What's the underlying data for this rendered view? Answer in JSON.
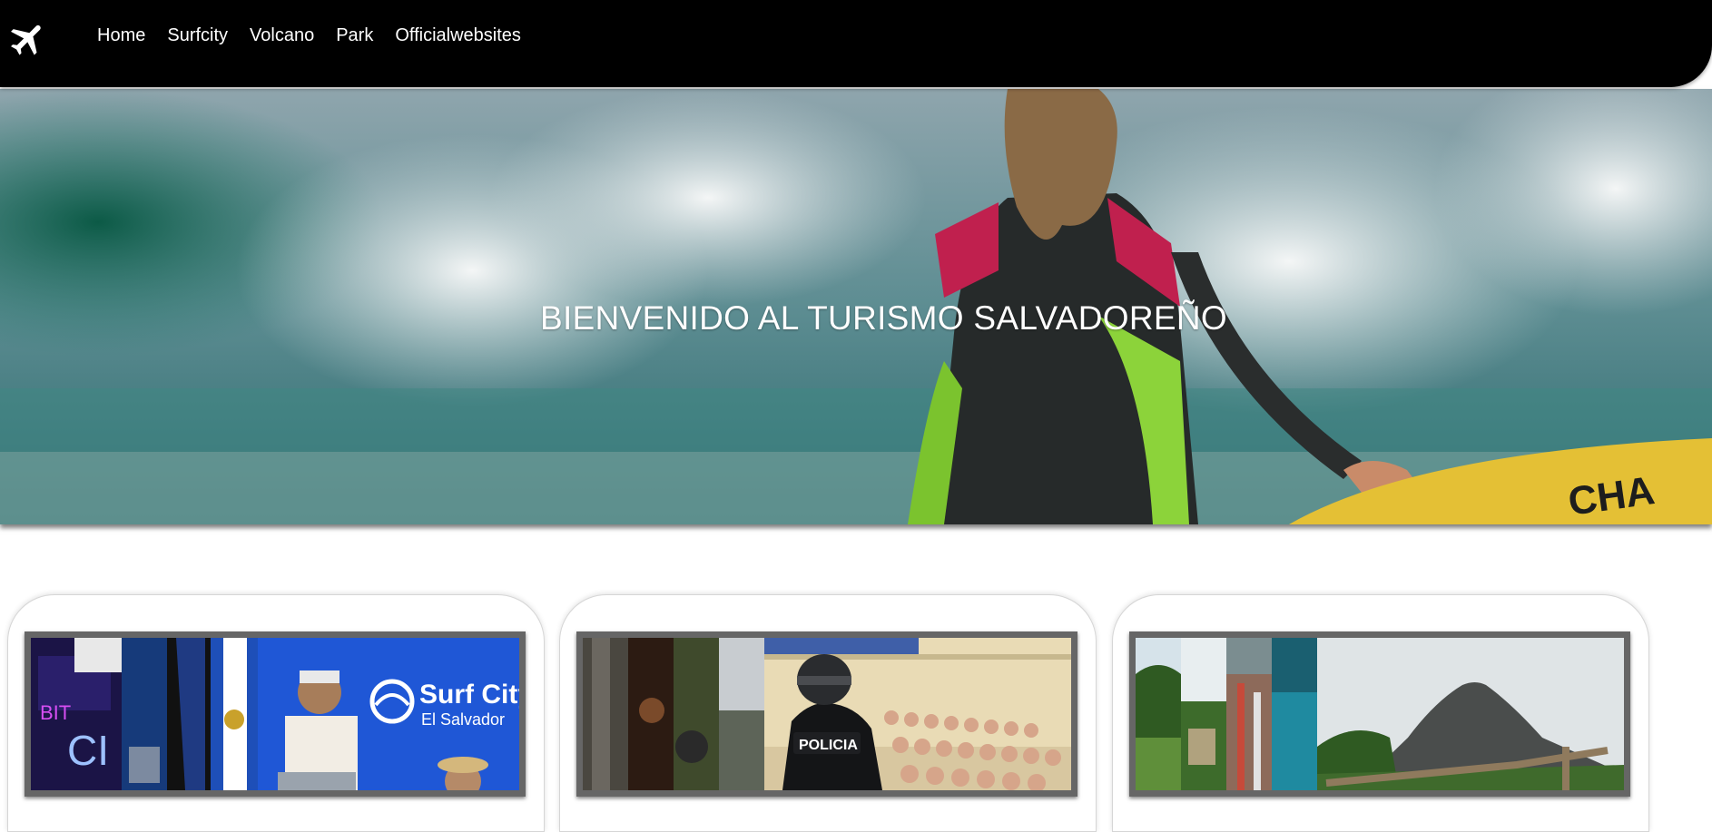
{
  "navbar": {
    "logo_icon": "airplane-icon",
    "links": [
      "Home",
      "Surfcity",
      "Volcano",
      "Park",
      "Officialwebsites"
    ]
  },
  "hero": {
    "title": "BIENVENIDO AL TURISMO SALVADOREÑO",
    "board_text": "CHA"
  },
  "cards": [
    {
      "name": "surf-city",
      "signs": [
        "BIT",
        "CI"
      ],
      "banner_title": "Surf City",
      "banner_subtitle": "El Salvador"
    },
    {
      "name": "security",
      "vest_label": "POLICIA"
    },
    {
      "name": "volcano"
    }
  ]
}
